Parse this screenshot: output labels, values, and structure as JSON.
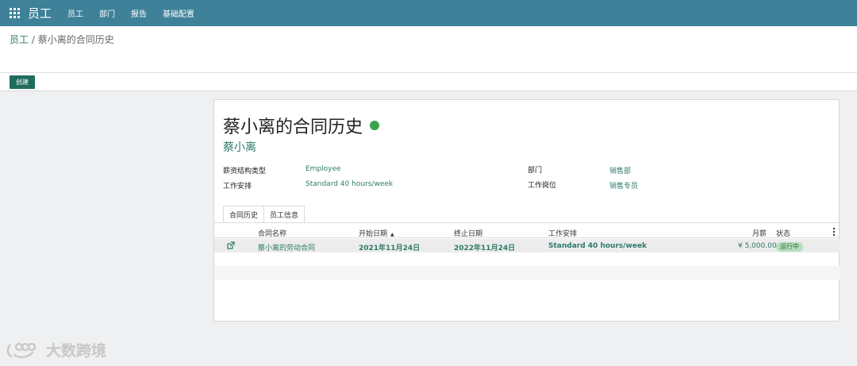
{
  "navbar": {
    "brand": "员工",
    "items": [
      "员工",
      "部门",
      "报告",
      "基础配置"
    ]
  },
  "breadcrumb": {
    "parent": "员工",
    "separator": " / ",
    "current": "蔡小离的合同历史"
  },
  "buttons": {
    "create": "创建"
  },
  "sheet": {
    "title": "蔡小离的合同历史",
    "status": "active",
    "employee_name": "蔡小离",
    "fields": {
      "salary_structure_label": "薪资结构类型",
      "salary_structure_value": "Employee",
      "work_schedule_label": "工作安排",
      "work_schedule_value": "Standard 40 hours/week",
      "department_label": "部门",
      "department_value": "销售部",
      "job_position_label": "工作岗位",
      "job_position_value": "销售专员"
    },
    "tabs": [
      "合同历史",
      "员工信息"
    ],
    "table": {
      "headers": [
        "合同名称",
        "开始日期",
        "终止日期",
        "工作安排",
        "月薪",
        "状态"
      ],
      "rows": [
        {
          "name": "蔡小离的劳动合同",
          "start_date": "2021年11月24日",
          "end_date": "2022年11月24日",
          "schedule": "Standard 40 hours/week",
          "salary": "¥ 5,000.00",
          "status": "运行中"
        }
      ]
    }
  },
  "watermark": {
    "text": "大数跨境"
  },
  "colors": {
    "navbar": "#3e8199",
    "primary_button": "#1f6d5e",
    "link": "#2f7a6b",
    "status_dot": "#3aa24b",
    "status_badge": "#b7dfbd"
  }
}
